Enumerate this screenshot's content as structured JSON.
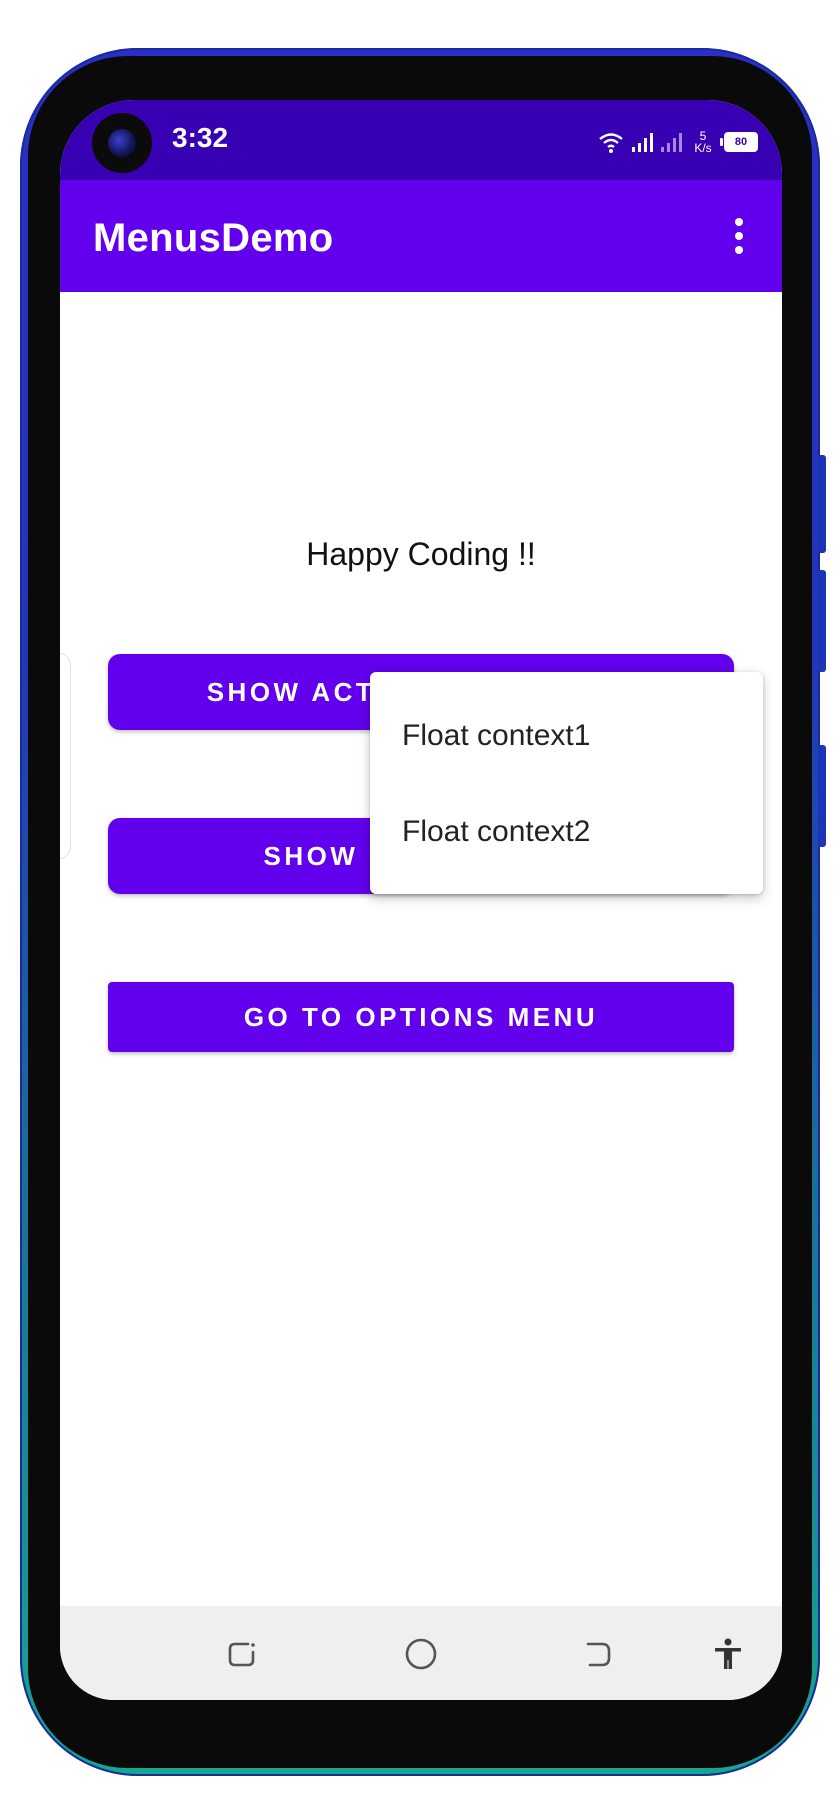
{
  "status_bar": {
    "time": "3:32",
    "net_speed_value": "5",
    "net_speed_unit": "K/s",
    "battery": "80",
    "wifi_icon": "wifi-icon",
    "signal_icon": "signal-icon"
  },
  "app_bar": {
    "title": "MenusDemo",
    "overflow_icon": "more-vert-icon"
  },
  "main": {
    "greeting": "Happy Coding !!",
    "buttons": [
      {
        "label": "SHOW ACT"
      },
      {
        "label": "SHOW POPUP MENU"
      },
      {
        "label": "GO TO OPTIONS MENU"
      }
    ]
  },
  "floating_context_menu": {
    "items": [
      {
        "label": "Float context1"
      },
      {
        "label": "Float context2"
      }
    ]
  },
  "nav_bar": {
    "icons": [
      "recents-icon",
      "home-icon",
      "back-icon",
      "accessibility-icon"
    ]
  },
  "colors": {
    "status_bar": "#3700b3",
    "app_bar": "#6200ee",
    "button": "#6200ee",
    "nav_bar": "#efefef"
  }
}
